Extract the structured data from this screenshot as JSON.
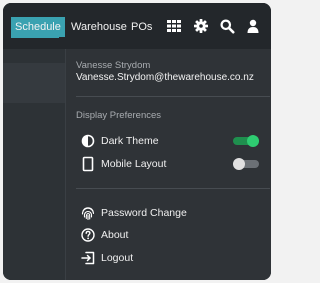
{
  "nav": {
    "tabs": [
      {
        "label": "Schedule",
        "active": true
      },
      {
        "label": "Warehouse",
        "active": false
      },
      {
        "label": "POs",
        "active": false
      }
    ],
    "icons": [
      "grid-icon",
      "gear-icon",
      "search-icon",
      "user-icon"
    ]
  },
  "user": {
    "name": "Vanesse Strydom",
    "email": "Vanesse.Strydom@thewarehouse.co.nz"
  },
  "preferences": {
    "heading": "Display Preferences",
    "dark_theme": {
      "label": "Dark Theme",
      "icon": "contrast-icon",
      "enabled": true
    },
    "mobile_layout": {
      "label": "Mobile Layout",
      "icon": "mobile-icon",
      "enabled": false
    }
  },
  "actions": {
    "password_change": {
      "label": "Password Change",
      "icon": "fingerprint-icon"
    },
    "about": {
      "label": "About",
      "icon": "help-circle-icon"
    },
    "logout": {
      "label": "Logout",
      "icon": "logout-icon"
    }
  },
  "colors": {
    "accent": "#3aa2b1",
    "toggle_on_knob": "#2ecc71",
    "toggle_on_track": "#1f8f4e",
    "toggle_off_knob": "#e0e0e0",
    "toggle_off_track": "#6b7075"
  }
}
